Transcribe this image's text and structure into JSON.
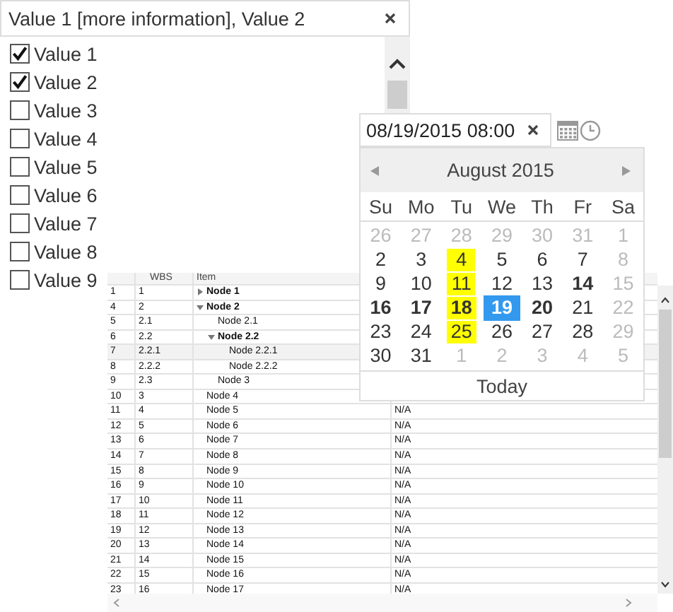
{
  "multiselect": {
    "value": "Value 1 [more information], Value 2",
    "items": [
      {
        "label": "Value 1",
        "checked": true
      },
      {
        "label": "Value 2",
        "checked": true
      },
      {
        "label": "Value 3",
        "checked": false
      },
      {
        "label": "Value 4",
        "checked": false
      },
      {
        "label": "Value 5",
        "checked": false
      },
      {
        "label": "Value 6",
        "checked": false
      },
      {
        "label": "Value 7",
        "checked": false
      },
      {
        "label": "Value 8",
        "checked": false
      },
      {
        "label": "Value 9",
        "checked": false
      }
    ]
  },
  "grid": {
    "columns": [
      "WBS",
      "Item"
    ],
    "rows": [
      {
        "row_number": "1",
        "wbs": "1",
        "item": "Node 1",
        "expanded": false,
        "selected": false
      },
      {
        "row_number": "4",
        "wbs": "2",
        "item": "Node 2",
        "expanded": true,
        "selected": false,
        "children": [
          {
            "row_number": "5",
            "wbs": "2.1",
            "item": "Node 2.1",
            "selected": false
          },
          {
            "row_number": "6",
            "wbs": "2.2",
            "item": "Node 2.2",
            "expanded": true,
            "selected": false,
            "children": [
              {
                "row_number": "7",
                "wbs": "2.2.1",
                "item": "Node 2.2.1",
                "selected": true
              },
              {
                "row_number": "8",
                "wbs": "2.2.2",
                "item": "Node 2.2.2",
                "selected": false
              }
            ]
          },
          {
            "row_number": "9",
            "wbs": "2.3",
            "item": "Node 3",
            "selected": false
          }
        ]
      },
      {
        "row_number": "10",
        "wbs": "3",
        "item": "Node 4",
        "selected": false
      },
      {
        "row_number": "11",
        "wbs": "4",
        "item": "Node 5",
        "selected": false,
        "column_4": "N/A"
      },
      {
        "row_number": "12",
        "wbs": "5",
        "item": "Node 6",
        "selected": false,
        "column_4": "N/A"
      },
      {
        "row_number": "13",
        "wbs": "6",
        "item": "Node 7",
        "selected": false,
        "column_4": "N/A"
      },
      {
        "row_number": "14",
        "wbs": "7",
        "item": "Node 8",
        "selected": false,
        "column_4": "N/A"
      },
      {
        "row_number": "15",
        "wbs": "8",
        "item": "Node 9",
        "selected": false,
        "column_4": "N/A"
      },
      {
        "row_number": "16",
        "wbs": "9",
        "item": "Node 10",
        "selected": false,
        "column_4": "N/A"
      },
      {
        "row_number": "17",
        "wbs": "10",
        "item": "Node 11",
        "selected": false,
        "column_4": "N/A"
      },
      {
        "row_number": "18",
        "wbs": "11",
        "item": "Node 12",
        "selected": false,
        "column_4": "N/A"
      },
      {
        "row_number": "19",
        "wbs": "12",
        "item": "Node 13",
        "selected": false,
        "column_4": "N/A"
      },
      {
        "row_number": "20",
        "wbs": "13",
        "item": "Node 14",
        "selected": false,
        "column_4": "N/A"
      },
      {
        "row_number": "21",
        "wbs": "14",
        "item": "Node 15",
        "selected": false,
        "column_4": "N/A"
      },
      {
        "row_number": "22",
        "wbs": "15",
        "item": "Node 16",
        "selected": false,
        "column_4": "N/A"
      },
      {
        "row_number": "23",
        "wbs": "16",
        "item": "Node 17",
        "selected": false,
        "column_4": "N/A"
      }
    ]
  },
  "datetime_picker": {
    "value": "08/19/2015 08:00",
    "calendar": {
      "month_label": "August 2015",
      "weekdays": [
        "Su",
        "Mo",
        "Tu",
        "We",
        "Th",
        "Fr",
        "Sa"
      ],
      "weeks": [
        [
          {
            "day": "26",
            "muted": true,
            "bold": false,
            "highlighted": false,
            "selected": false
          },
          {
            "day": "27",
            "muted": true,
            "bold": false,
            "highlighted": false,
            "selected": false
          },
          {
            "day": "28",
            "muted": true,
            "bold": false,
            "highlighted": false,
            "selected": false
          },
          {
            "day": "29",
            "muted": true,
            "bold": false,
            "highlighted": false,
            "selected": false
          },
          {
            "day": "30",
            "muted": true,
            "bold": false,
            "highlighted": false,
            "selected": false
          },
          {
            "day": "31",
            "muted": true,
            "bold": false,
            "highlighted": false,
            "selected": false
          },
          {
            "day": "1",
            "muted": true,
            "bold": false,
            "highlighted": false,
            "selected": false
          }
        ],
        [
          {
            "day": "2",
            "muted": false,
            "bold": false,
            "highlighted": false,
            "selected": false
          },
          {
            "day": "3",
            "muted": false,
            "bold": false,
            "highlighted": false,
            "selected": false
          },
          {
            "day": "4",
            "muted": false,
            "bold": false,
            "highlighted": true,
            "selected": false
          },
          {
            "day": "5",
            "muted": false,
            "bold": false,
            "highlighted": false,
            "selected": false
          },
          {
            "day": "6",
            "muted": false,
            "bold": false,
            "highlighted": false,
            "selected": false
          },
          {
            "day": "7",
            "muted": false,
            "bold": false,
            "highlighted": false,
            "selected": false
          },
          {
            "day": "8",
            "muted": true,
            "bold": false,
            "highlighted": false,
            "selected": false
          }
        ],
        [
          {
            "day": "9",
            "muted": false,
            "bold": false,
            "highlighted": false,
            "selected": false
          },
          {
            "day": "10",
            "muted": false,
            "bold": false,
            "highlighted": false,
            "selected": false
          },
          {
            "day": "11",
            "muted": false,
            "bold": false,
            "highlighted": true,
            "selected": false
          },
          {
            "day": "12",
            "muted": false,
            "bold": false,
            "highlighted": false,
            "selected": false
          },
          {
            "day": "13",
            "muted": false,
            "bold": false,
            "highlighted": false,
            "selected": false
          },
          {
            "day": "14",
            "muted": false,
            "bold": true,
            "highlighted": false,
            "selected": false
          },
          {
            "day": "15",
            "muted": true,
            "bold": false,
            "highlighted": false,
            "selected": false
          }
        ],
        [
          {
            "day": "16",
            "muted": false,
            "bold": true,
            "highlighted": false,
            "selected": false
          },
          {
            "day": "17",
            "muted": false,
            "bold": true,
            "highlighted": false,
            "selected": false
          },
          {
            "day": "18",
            "muted": false,
            "bold": true,
            "highlighted": true,
            "selected": false
          },
          {
            "day": "19",
            "muted": false,
            "bold": true,
            "highlighted": false,
            "selected": true
          },
          {
            "day": "20",
            "muted": false,
            "bold": true,
            "highlighted": false,
            "selected": false
          },
          {
            "day": "21",
            "muted": false,
            "bold": false,
            "highlighted": false,
            "selected": false
          },
          {
            "day": "22",
            "muted": true,
            "bold": false,
            "highlighted": false,
            "selected": false
          }
        ],
        [
          {
            "day": "23",
            "muted": false,
            "bold": false,
            "highlighted": false,
            "selected": false
          },
          {
            "day": "24",
            "muted": false,
            "bold": false,
            "highlighted": false,
            "selected": false
          },
          {
            "day": "25",
            "muted": false,
            "bold": false,
            "highlighted": true,
            "selected": false
          },
          {
            "day": "26",
            "muted": false,
            "bold": false,
            "highlighted": false,
            "selected": false
          },
          {
            "day": "27",
            "muted": false,
            "bold": false,
            "highlighted": false,
            "selected": false
          },
          {
            "day": "28",
            "muted": false,
            "bold": false,
            "highlighted": false,
            "selected": false
          },
          {
            "day": "29",
            "muted": true,
            "bold": false,
            "highlighted": false,
            "selected": false
          }
        ],
        [
          {
            "day": "30",
            "muted": false,
            "bold": false,
            "highlighted": false,
            "selected": false
          },
          {
            "day": "31",
            "muted": false,
            "bold": false,
            "highlighted": false,
            "selected": false
          },
          {
            "day": "1",
            "muted": true,
            "bold": false,
            "highlighted": false,
            "selected": false
          },
          {
            "day": "2",
            "muted": true,
            "bold": false,
            "highlighted": false,
            "selected": false
          },
          {
            "day": "3",
            "muted": true,
            "bold": false,
            "highlighted": false,
            "selected": false
          },
          {
            "day": "4",
            "muted": true,
            "bold": false,
            "highlighted": false,
            "selected": false
          },
          {
            "day": "5",
            "muted": true,
            "bold": false,
            "highlighted": false,
            "selected": false
          }
        ]
      ],
      "footer": "Today"
    }
  }
}
